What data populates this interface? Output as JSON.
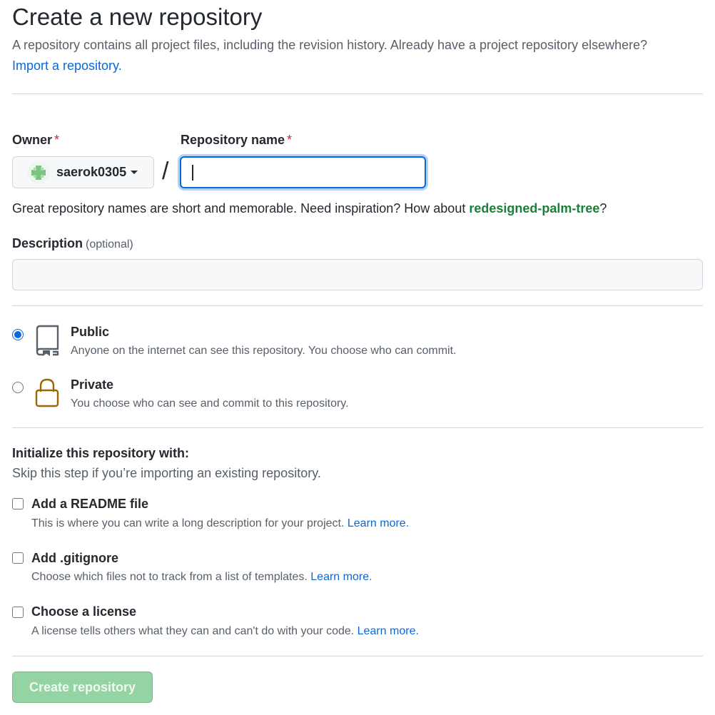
{
  "header": {
    "title": "Create a new repository",
    "description": "A repository contains all project files, including the revision history. Already have a project repository elsewhere?",
    "import_link": "Import a repository."
  },
  "owner": {
    "label": "Owner",
    "required_mark": "*",
    "selected": "saerok0305"
  },
  "repo_name": {
    "label": "Repository name",
    "required_mark": "*",
    "value": "",
    "separator": "/"
  },
  "hint": {
    "text": "Great repository names are short and memorable. Need inspiration? How about ",
    "suggestion": "redesigned-palm-tree",
    "suffix": "?"
  },
  "description": {
    "label": "Description",
    "optional": "(optional)",
    "value": ""
  },
  "visibility": {
    "selected": "public",
    "public": {
      "title": "Public",
      "desc": "Anyone on the internet can see this repository. You choose who can commit."
    },
    "private": {
      "title": "Private",
      "desc": "You choose who can see and commit to this repository."
    }
  },
  "init": {
    "title": "Initialize this repository with:",
    "subtitle": "Skip this step if you’re importing an existing repository.",
    "options": [
      {
        "title": "Add a README file",
        "desc": "This is where you can write a long description for your project.",
        "link": "Learn more.",
        "checked": false
      },
      {
        "title": "Add .gitignore",
        "desc": "Choose which files not to track from a list of templates.",
        "link": "Learn more.",
        "checked": false
      },
      {
        "title": "Choose a license",
        "desc": "A license tells others what they can and can't do with your code.",
        "link": "Learn more.",
        "checked": false
      }
    ]
  },
  "submit": {
    "label": "Create repository",
    "disabled": true
  },
  "colors": {
    "link": "#0969da",
    "required": "#cf222e",
    "suggestion": "#1a7f37",
    "lock_icon": "#9a6700",
    "button_disabled": "#94d3a2"
  },
  "icons": {
    "avatar": "identicon-avatar",
    "public": "repo-icon",
    "private": "lock-icon",
    "owner_dropdown": "caret-down-icon"
  }
}
